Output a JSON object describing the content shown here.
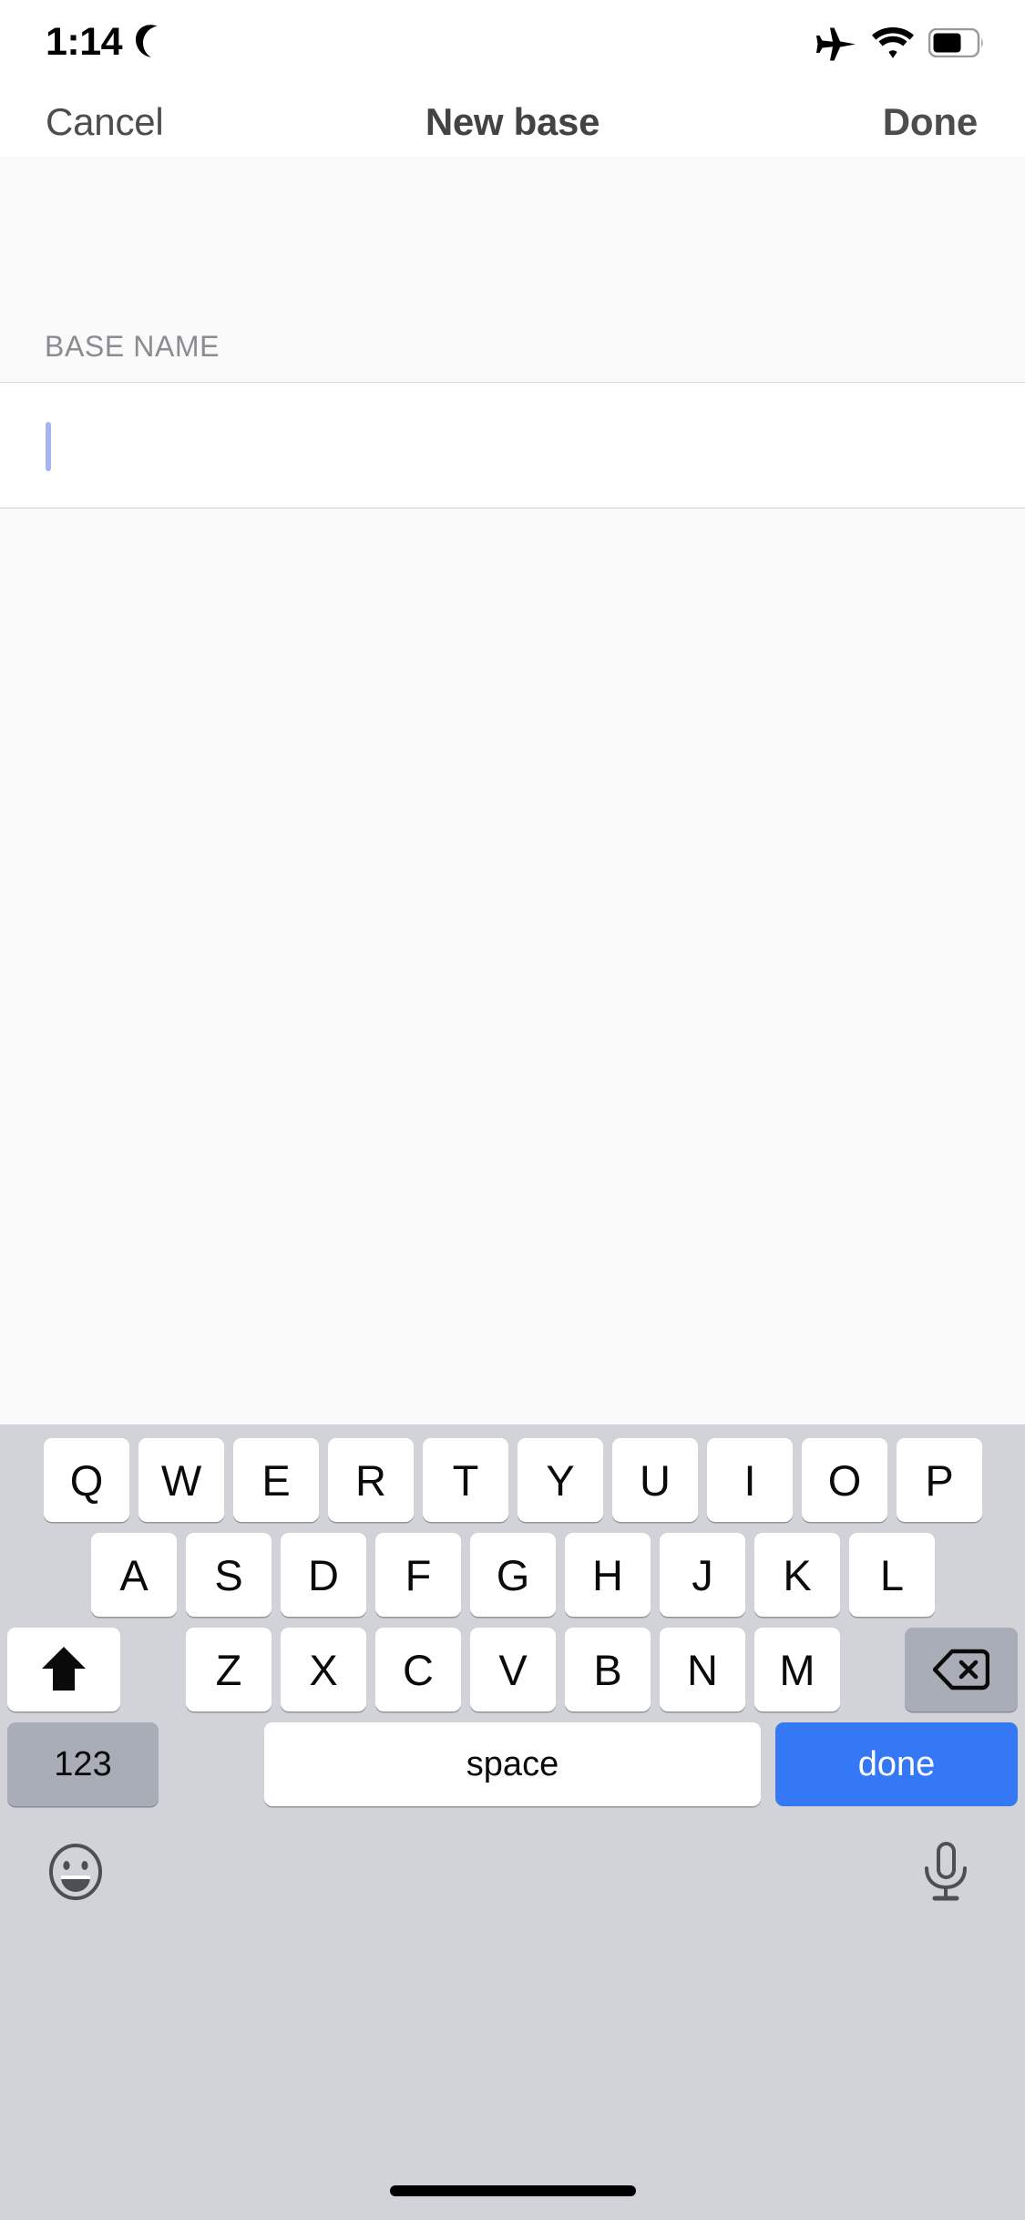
{
  "status_bar": {
    "time": "1:14",
    "moon_icon": "crescent-moon-icon",
    "airplane_icon": "airplane-mode-icon",
    "wifi_icon": "wifi-icon",
    "battery_icon": "battery-icon"
  },
  "nav_bar": {
    "cancel_label": "Cancel",
    "title": "New base",
    "done_label": "Done"
  },
  "form": {
    "section_header": "BASE NAME",
    "name_value": "",
    "name_placeholder": ""
  },
  "keyboard": {
    "row1": [
      "Q",
      "W",
      "E",
      "R",
      "T",
      "Y",
      "U",
      "I",
      "O",
      "P"
    ],
    "row2": [
      "A",
      "S",
      "D",
      "F",
      "G",
      "H",
      "J",
      "K",
      "L"
    ],
    "row3": [
      "Z",
      "X",
      "C",
      "V",
      "B",
      "N",
      "M"
    ],
    "shift_icon": "shift-arrow-icon",
    "delete_icon": "backspace-delete-icon",
    "numbers_label": "123",
    "space_label": "space",
    "done_label": "done",
    "emoji_icon": "emoji-smiley-icon",
    "dictation_icon": "microphone-icon"
  },
  "colors": {
    "accent_blue": "#3578f6",
    "caret_blue": "#a4b5f1",
    "keyboard_bg": "#d1d3d9",
    "key_white": "#ffffff",
    "key_gray": "#a9adb7",
    "nav_text": "#4d4d4d",
    "section_header_text": "#8b8b90",
    "content_bg": "#fafafb"
  },
  "home_indicator": "home-indicator-bar"
}
